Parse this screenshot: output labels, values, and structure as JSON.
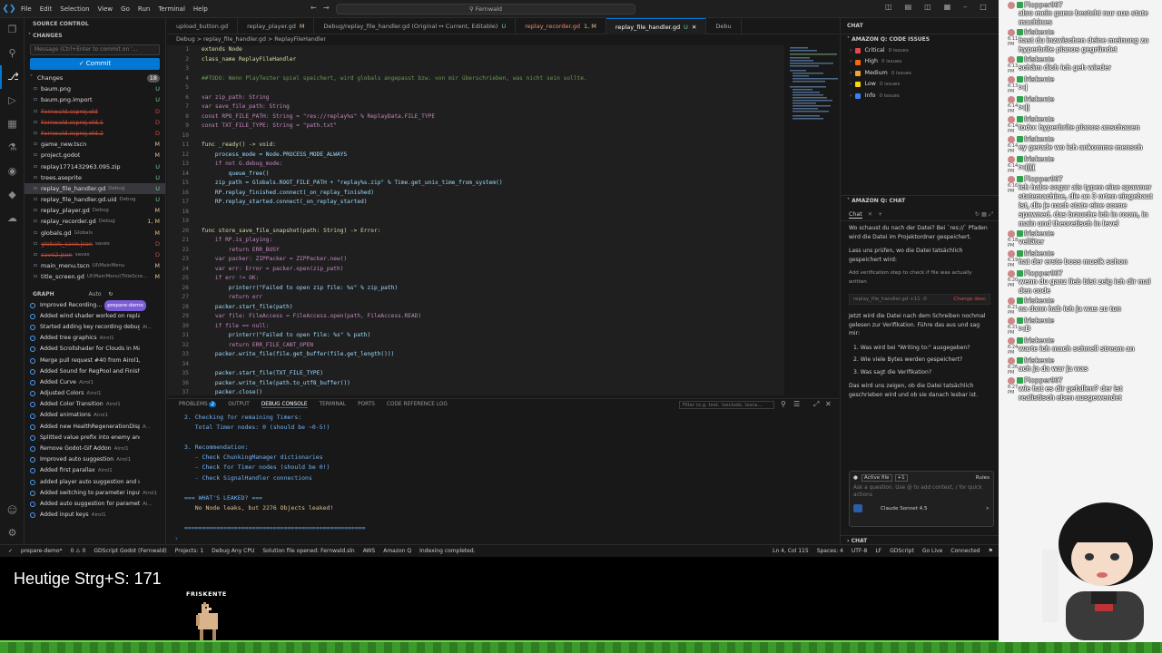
{
  "titlebar": {
    "menu": [
      "File",
      "Edit",
      "Selection",
      "View",
      "Go",
      "Run",
      "Terminal",
      "Help"
    ],
    "search": "Fernwald"
  },
  "sidebar": {
    "title": "SOURCE CONTROL",
    "changes_header": "CHANGES",
    "message_placeholder": "Message (Ctrl+Enter to commit on '...",
    "commit_label": "Commit",
    "changes_group": "Changes",
    "changes_count": "18",
    "files": [
      {
        "name": "baum.png",
        "dir": "",
        "status": "U",
        "cls": "U"
      },
      {
        "name": "baum.png.import",
        "dir": "",
        "status": "U",
        "cls": "U"
      },
      {
        "name": "Fernwald.csproj.old",
        "dir": "",
        "status": "D",
        "cls": "D",
        "strike": true
      },
      {
        "name": "Fernwald.csproj.old.1",
        "dir": "",
        "status": "D",
        "cls": "D",
        "strike": true
      },
      {
        "name": "Fernwald.csproj.old.2",
        "dir": "",
        "status": "D",
        "cls": "D",
        "strike": true
      },
      {
        "name": "game_new.tscn",
        "dir": "",
        "status": "M",
        "cls": "M"
      },
      {
        "name": "project.godot",
        "dir": "",
        "status": "M",
        "cls": "M"
      },
      {
        "name": "replay1771432963.095.zip",
        "dir": "",
        "status": "U",
        "cls": "U"
      },
      {
        "name": "trees.aseprite",
        "dir": "",
        "status": "U",
        "cls": "U"
      },
      {
        "name": "replay_file_handler.gd",
        "dir": "Debug",
        "status": "U",
        "cls": "U",
        "sel": true
      },
      {
        "name": "replay_file_handler.gd.uid",
        "dir": "Debug",
        "status": "U",
        "cls": "U"
      },
      {
        "name": "replay_player.gd",
        "dir": "Debug",
        "status": "M",
        "cls": "M"
      },
      {
        "name": "replay_recorder.gd",
        "dir": "Debug",
        "status": "1, M",
        "cls": "M"
      },
      {
        "name": "globals.gd",
        "dir": "Globals",
        "status": "M",
        "cls": "M"
      },
      {
        "name": "globals_save.json",
        "dir": "saves",
        "status": "D",
        "cls": "D",
        "strike": true
      },
      {
        "name": "save2.json",
        "dir": "saves",
        "status": "D",
        "cls": "D",
        "strike": true
      },
      {
        "name": "main_menu.tscn",
        "dir": "UI\\MainMenu",
        "status": "M",
        "cls": "M"
      },
      {
        "name": "title_screen.gd",
        "dir": "UI\\MainMenu\\TitleScre...",
        "status": "M",
        "cls": "M"
      }
    ],
    "graph_title": "GRAPH",
    "graph_auto": "Auto",
    "graph": [
      {
        "label": "Improved Recording...",
        "author": "prepare-demo"
      },
      {
        "label": "Added wind shader worked on replay functi...",
        "author": ""
      },
      {
        "label": "Started adding key recording debug tool",
        "author": "Ai..."
      },
      {
        "label": "Added tree graphics",
        "author": "Airol1"
      },
      {
        "label": "Added Scrollshader for Clouds in MainMen...",
        "author": ""
      },
      {
        "label": "Merge pull request #40 from Airol1/Impl...",
        "author": ""
      },
      {
        "label": "Added Sound for RegPool and Finished C...",
        "author": ""
      },
      {
        "label": "Added Curve",
        "author": "Airol1"
      },
      {
        "label": "Adjusted Colors",
        "author": "Airol1"
      },
      {
        "label": "Added Color Transition",
        "author": "Airol1"
      },
      {
        "label": "Added animations",
        "author": "Airol1"
      },
      {
        "label": "Added new HealthRegenerationDisplay",
        "author": "A..."
      },
      {
        "label": "Splitted value prefix into enemy and obje...",
        "author": ""
      },
      {
        "label": "Remove Godot-Gif Addon",
        "author": "Airol1"
      },
      {
        "label": "Improved auto suggestion",
        "author": "Airol1"
      },
      {
        "label": "Added first parallax",
        "author": "Airol1"
      },
      {
        "label": "added player auto suggestion and upgra...",
        "author": ""
      },
      {
        "label": "Added switching to parameter input",
        "author": "Airol1"
      },
      {
        "label": "Added auto suggestion for parameters",
        "author": "Ai..."
      },
      {
        "label": "Added input keys",
        "author": "Airol1"
      }
    ]
  },
  "editor": {
    "tabs": [
      {
        "label": "upload_button.gd",
        "mark": ""
      },
      {
        "label": "replay_player.gd",
        "mark": "M"
      },
      {
        "label": "Debug/replay_file_handler.gd (Original ↔ Current, Editable)",
        "mark": "U"
      },
      {
        "label": "replay_recorder.gd",
        "mark": "1, M"
      },
      {
        "label": "replay_file_handler.gd",
        "mark": "U"
      },
      {
        "label": "Debu",
        "mark": ""
      }
    ],
    "breadcrumb": "Debug > replay_file_handler.gd > ReplayFileHandler",
    "lines": [
      {
        "n": "1",
        "t": "extends Node"
      },
      {
        "n": "2",
        "t": "class_name ReplayFileHandler"
      },
      {
        "n": "3",
        "t": ""
      },
      {
        "n": "4",
        "t": "##TODO: Wenn PlayTester spiel speichert, wird globals angepasst bzw. von mir überschrieben, was nicht sein sollte."
      },
      {
        "n": "5",
        "t": ""
      },
      {
        "n": "6",
        "t": "var zip_path: String"
      },
      {
        "n": "7",
        "t": "var save_file_path: String"
      },
      {
        "n": "8",
        "t": "const RPO_FILE_PATH: String = \"res://replay%s\" % ReplayData.FILE_TYPE"
      },
      {
        "n": "9",
        "t": "const TXT_FILE_TYPE: String = \"path.txt\""
      },
      {
        "n": "10",
        "t": ""
      },
      {
        "n": "11",
        "t": "func _ready() -> void:"
      },
      {
        "n": "12",
        "t": "    process_mode = Node.PROCESS_MODE_ALWAYS"
      },
      {
        "n": "13",
        "t": "    if not G.debug_mode:"
      },
      {
        "n": "14",
        "t": "        queue_free()"
      },
      {
        "n": "15",
        "t": "    zip_path = Globals.ROOT_FILE_PATH + \"replay%s.zip\" % Time.get_unix_time_from_system()"
      },
      {
        "n": "16",
        "t": "    RP.replay_finished.connect(_on_replay_finished)"
      },
      {
        "n": "17",
        "t": "    RP.replay_started.connect(_on_replay_started)"
      },
      {
        "n": "18",
        "t": ""
      },
      {
        "n": "19",
        "t": ""
      },
      {
        "n": "20",
        "t": "func store_save_file_snapshot(path: String) -> Error:"
      },
      {
        "n": "21",
        "t": "    if RP.is_playing:"
      },
      {
        "n": "22",
        "t": "        return ERR_BUSY"
      },
      {
        "n": "23",
        "t": "    var packer: ZIPPacker = ZIPPacker.new()"
      },
      {
        "n": "24",
        "t": "    var err: Error = packer.open(zip_path)"
      },
      {
        "n": "25",
        "t": "    if err != OK:"
      },
      {
        "n": "26",
        "t": "        printerr(\"Failed to open zip file: %s\" % zip_path)"
      },
      {
        "n": "27",
        "t": "        return err"
      },
      {
        "n": "28",
        "t": "    packer.start_file(path)"
      },
      {
        "n": "29",
        "t": "    var file: FileAccess = FileAccess.open(path, FileAccess.READ)"
      },
      {
        "n": "30",
        "t": "    if file == null:"
      },
      {
        "n": "31",
        "t": "        printerr(\"Failed to open file: %s\" % path)"
      },
      {
        "n": "32",
        "t": "        return ERR_FILE_CANT_OPEN"
      },
      {
        "n": "33",
        "t": "    packer.write_file(file.get_buffer(file.get_length()))"
      },
      {
        "n": "34",
        "t": ""
      },
      {
        "n": "35",
        "t": "    packer.start_file(TXT_FILE_TYPE)"
      },
      {
        "n": "36",
        "t": "    packer.write_file(path.to_utf8_buffer())"
      },
      {
        "n": "37",
        "t": "    packer.close()"
      }
    ]
  },
  "panel": {
    "tabs": [
      "PROBLEMS",
      "OUTPUT",
      "DEBUG CONSOLE",
      "TERMINAL",
      "PORTS",
      "CODE REFERENCE LOG"
    ],
    "problems_count": "2",
    "filter_placeholder": "Filter (e.g. text, !exclude, \\esca...",
    "output": [
      "2. Checking for remaining Timers:",
      "   Total Timer nodes: 0 (should be ~0-5!)",
      "",
      "3. Recommendation:",
      "   - Check ChunkingManager dictionaries",
      "   - Check for Timer nodes (should be 0!)",
      "   - Check SignalHandler connections",
      "",
      "=== WHAT'S LEAKED? ===",
      "   No Node leaks, but 2276 Objects leaked!",
      "",
      "==================================================="
    ]
  },
  "right": {
    "tab_chat": "CHAT",
    "issues_title": "AMAZON Q: CODE ISSUES",
    "issues": [
      {
        "label": "Critical",
        "count": "0 issues",
        "color": "#e5484d"
      },
      {
        "label": "High",
        "count": "0 issues",
        "color": "#f76808"
      },
      {
        "label": "Medium",
        "count": "0 issues",
        "color": "#f5a524"
      },
      {
        "label": "Low",
        "count": "0 issues",
        "color": "#f5d90a"
      },
      {
        "label": "Info",
        "count": "0 issues",
        "color": "#3b82f6"
      }
    ],
    "chat_title": "AMAZON Q: CHAT",
    "chat_tab": "Chat",
    "p1": "Wo schaust du nach der Datei? Bei `res://` Pfaden wird die Datei im Projektordner gespeichert.",
    "p2": "Lass uns prüfen, wo die Datei tatsächlich gespeichert wird:",
    "step": "Add verification step to check if file was actually written",
    "file_ref": "replay_file_handler.gd +11 -0",
    "change_label": "Change desc",
    "p3": "Jetzt wird die Datei nach dem Schreiben nochmal gelesen zur Verifikation. Führe das aus und sag mir:",
    "q1": "1. Was wird bei \"Writing to:\" ausgegeben?",
    "q2": "2. Wie viele Bytes werden gespeichert?",
    "q3": "3. Was sagt die Verifikation?",
    "p4": "Das wird uns zeigen, ob die Datei tatsächlich geschrieben wird und ob sie danach lesbar ist.",
    "active_file": "Active file",
    "rules": "Rules",
    "ask_placeholder": "Ask a question. Use @ to add context, / for quick actions",
    "model": "Claude Sonnet 4.5",
    "chat_footer": "CHAT"
  },
  "status": {
    "items": [
      "prepare-demo*",
      "0 ⚠ 0",
      "GDScript Godot (Fernwald)",
      "Projects: 1",
      "Debug Any CPU",
      "Solution file opened: Fernwald.sln",
      "AWS",
      "Amazon Q",
      "Indexing completed."
    ],
    "right": [
      "Ln 4, Col 115",
      "Spaces: 4",
      "UTF-8",
      "LF",
      "GDScript",
      "Go Live",
      "Connected"
    ]
  },
  "overlay": {
    "saves": "Heutige Strg+S: 171",
    "friskente": "FRISKENTE"
  },
  "chat": [
    {
      "name": "Flopper907",
      "time": "",
      "msg": "also mein game besteht nur aus state machines"
    },
    {
      "name": "friskente",
      "time": "6:11 PM",
      "msg": "hast du inzwischen deine meinung zu hyperbrite pianos gegründet"
    },
    {
      "name": "friskente",
      "time": "6:13 PM",
      "msg": "schäm dich ich geh wieder"
    },
    {
      "name": "friskente",
      "time": "6:13 PM",
      "msg": ">:|"
    },
    {
      "name": "friskente",
      "time": "6:14 PM",
      "msg": ">:||"
    },
    {
      "name": "friskente",
      "time": "6:14 PM",
      "msg": "todo: hyperbrite pianos anschauen"
    },
    {
      "name": "friskente",
      "time": "6:14 PM",
      "msg": "ey gerade wo ich ankomme mensch"
    },
    {
      "name": "friskente",
      "time": "6:14 PM",
      "msg": ">:(((("
    },
    {
      "name": "Flopper907",
      "time": "6:16 PM",
      "msg": "ich habe sogar ais typen eine spawner statemachine, die an 3 orten eingebaut ist, die je nach state eine scene spawned. das brauche ich in room, in main und theoretisch in level"
    },
    {
      "name": "friskente",
      "time": "6:18 PM",
      "msg": "velläter"
    },
    {
      "name": "friskente",
      "time": "6:19 PM",
      "msg": "hat der erste boss musik schon"
    },
    {
      "name": "Flopper907",
      "time": "6:20 PM",
      "msg": "wenn du ganz lieb bist zeig ich dir mal den code"
    },
    {
      "name": "friskente",
      "time": "6:21 PM",
      "msg": "na dann hab ich ja was zu tun"
    },
    {
      "name": "friskente",
      "time": "6:21 PM",
      "msg": ">:D"
    },
    {
      "name": "friskente",
      "time": "6:24 PM",
      "msg": "warte ich mach schnell stream an"
    },
    {
      "name": "friskente",
      "time": "6:26 PM",
      "msg": "ach ja da war ja was"
    },
    {
      "name": "Flopper907",
      "time": "6:27 PM",
      "msg": "wie hat es dir gefallen? der ist realistisch eben ausgewendet"
    }
  ]
}
